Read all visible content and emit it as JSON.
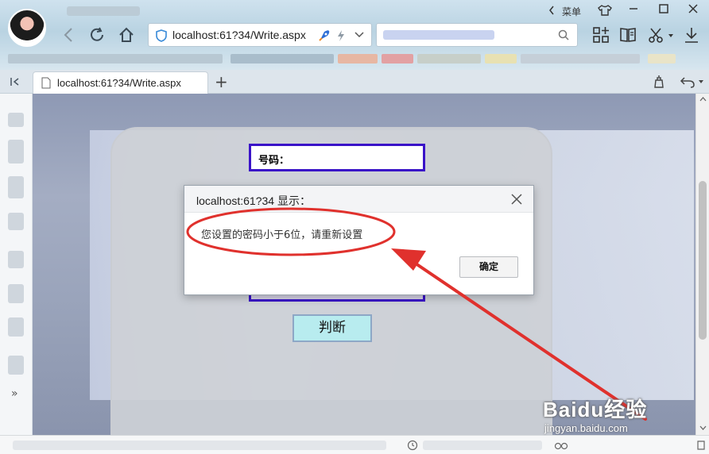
{
  "browser": {
    "url": "localhost:61?34/Write.aspx",
    "menu_label": "菜单",
    "tab_title": "localhost:61?34/Write.aspx",
    "new_tab_symbol": "+",
    "sidebar_expand": "»"
  },
  "page": {
    "phone_label": "号码：",
    "judge_button": "判断"
  },
  "dialog": {
    "title": "localhost:61?34 显示：",
    "message": "您设置的密码小于6位，请重新设置",
    "ok_label": "确定"
  },
  "watermark": {
    "main": "Baidu经验",
    "sub": "jingyan.baidu.com"
  },
  "colors": {
    "annotation": "#e0312d",
    "input_border": "#3a13c8",
    "judge_button_bg": "#b8ecef"
  }
}
